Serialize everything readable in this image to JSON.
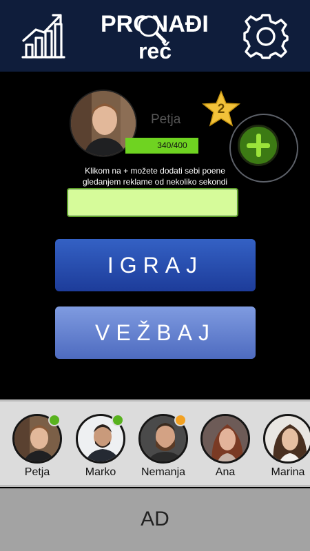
{
  "header": {
    "logo_line1": "PRONAĐI",
    "logo_line2": "reč",
    "stats_icon": "bar-chart-growth-icon",
    "settings_icon": "gear-icon"
  },
  "profile": {
    "name": "Petja",
    "level": "2",
    "xp_text": "340/400",
    "xp_progress": 0.85,
    "add_icon": "plus-icon",
    "hint": "Klikom na + možete dodati sebi poene gledanjem reklame od nekoliko sekondi",
    "ad_field_value": ""
  },
  "buttons": {
    "play": "IGRAJ",
    "practice": "VEŽBAJ"
  },
  "friends": [
    {
      "name": "Petja",
      "status_color": "#58b21e"
    },
    {
      "name": "Marko",
      "status_color": "#58b21e"
    },
    {
      "name": "Nemanja",
      "status_color": "#f2a122"
    },
    {
      "name": "Ana",
      "status_color": ""
    },
    {
      "name": "Marina",
      "status_color": ""
    }
  ],
  "ad": {
    "label": "AD"
  },
  "colors": {
    "header_bg": "#0f1d3b",
    "accent_green": "#6fd321",
    "play_blue": "#1d3c9a",
    "practice_blue": "#6b87d4"
  }
}
